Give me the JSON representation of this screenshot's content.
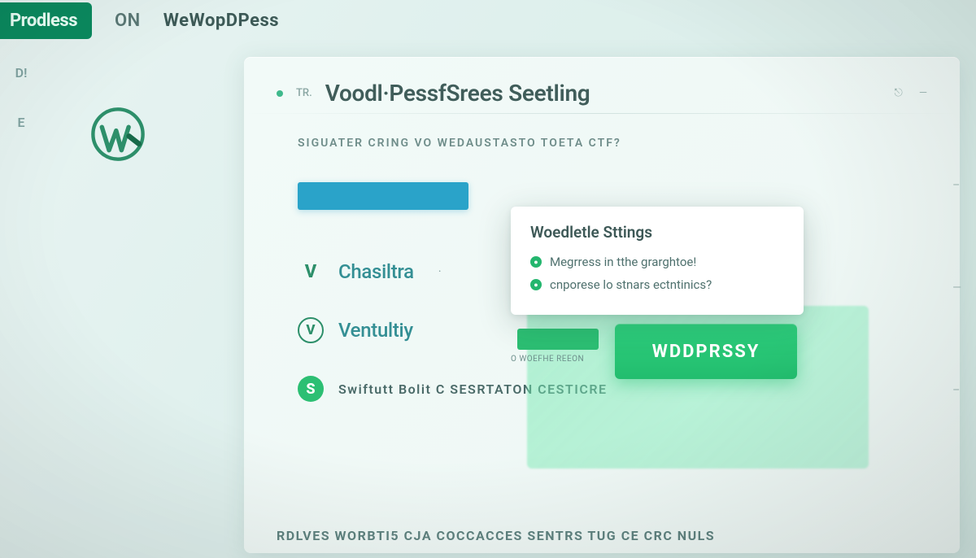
{
  "topbar": {
    "brand": "Prodless",
    "tab1": "ON",
    "tab2": "WeWopDPess"
  },
  "leftRail": {
    "item1": "D!",
    "item2": "E"
  },
  "panel": {
    "miniLabel": "TR.",
    "title": "Voodl·PessfSrees Seetling",
    "rightMeta1": "⎋",
    "rightMeta2": "—",
    "subtitle": "SIGUATER CRING VO WEDAUSTASTO TOETA CTF?",
    "items": [
      {
        "icon": "V",
        "label": "Chasiltra",
        "suffix": "·"
      },
      {
        "icon": "V",
        "label": "Ventultiy"
      },
      {
        "icon": "S",
        "label": "Swiftutt Bolit C SESRTATON CESTICRE"
      }
    ],
    "footer": "RDLVES WORBTI5 CJA COCCACCES  SENTRS  TUG CE CRC NULS"
  },
  "popup": {
    "title": "Woedletle Sttings",
    "items": [
      "Megrress in tthe grarghtoe!",
      "cnporese lo stnars ectntinics?"
    ]
  },
  "miniCaption": "O WOEFHE REEON",
  "cta": "WDDPRSSY",
  "rightFaint": {
    "a": "–",
    "b": "—",
    "c": "–"
  }
}
